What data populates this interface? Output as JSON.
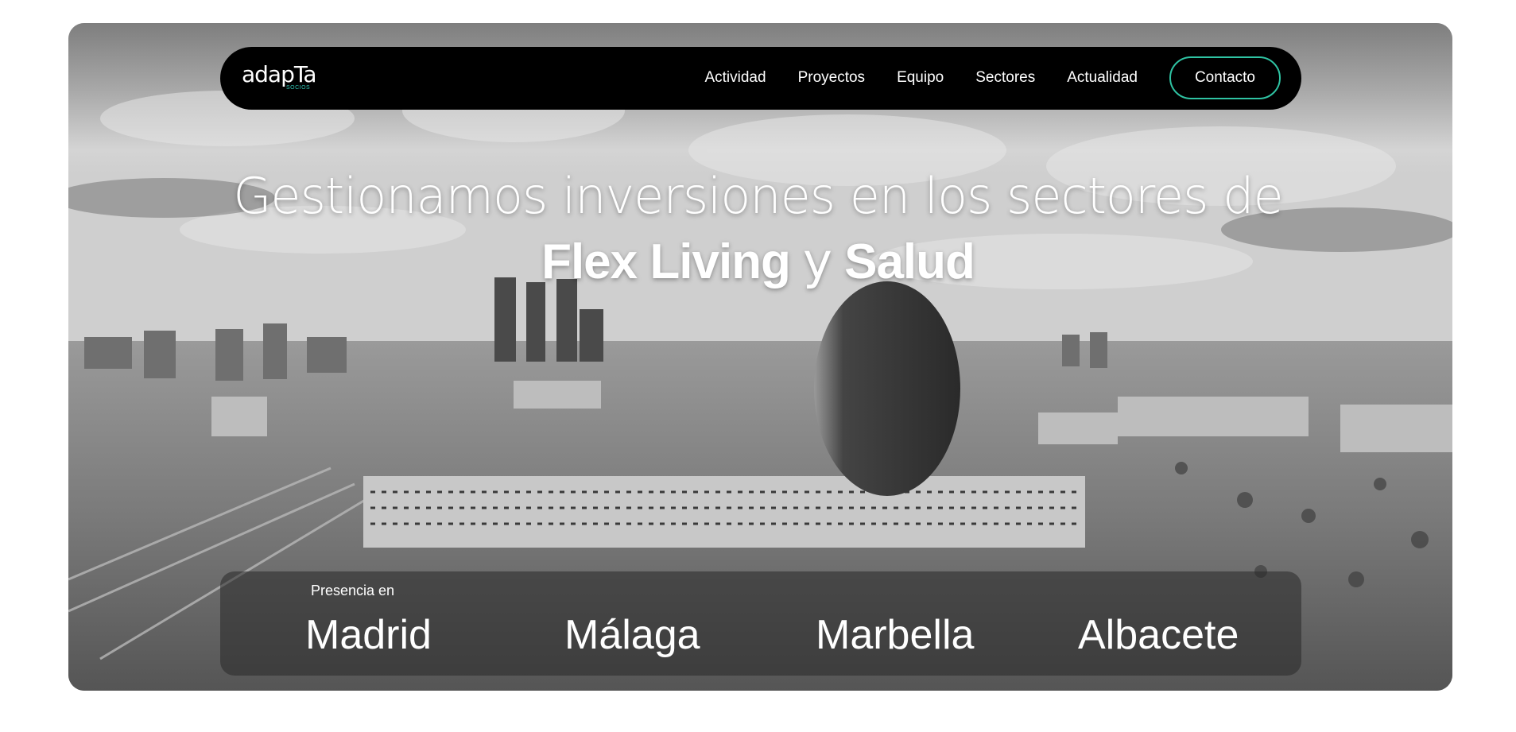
{
  "header": {
    "logo": {
      "main": "adapTa",
      "sub": "SOCIOS"
    },
    "nav": [
      "Actividad",
      "Proyectos",
      "Equipo",
      "Sectores",
      "Actualidad"
    ],
    "contact_label": "Contacto"
  },
  "hero": {
    "headline_line1": "Gestionamos inversiones en los sectores de",
    "headline_bold1": "Flex Living",
    "headline_connector": "y",
    "headline_bold2": "Salud",
    "presence_label": "Presencia en",
    "cities": [
      "Madrid",
      "Málaga",
      "Marbella",
      "Albacete"
    ]
  },
  "colors": {
    "accent": "#2fc3a3",
    "navbar": "#000000"
  }
}
